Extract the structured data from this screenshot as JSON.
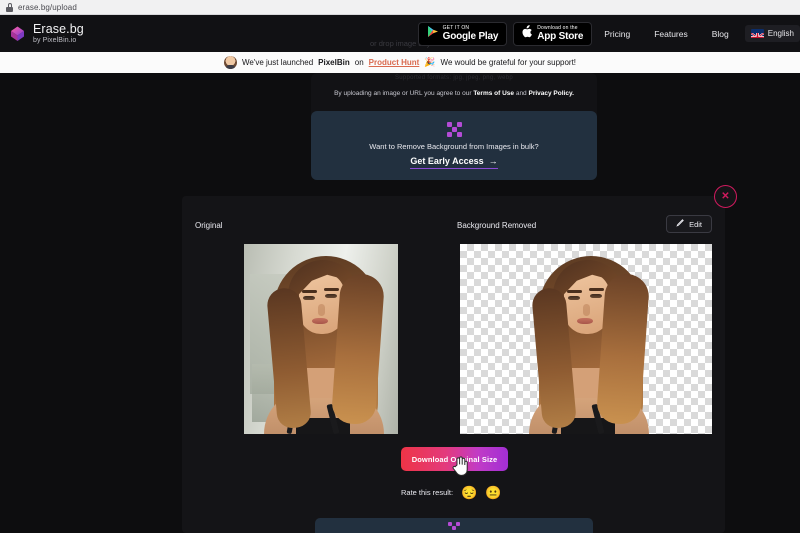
{
  "browser": {
    "url": "erase.bg/upload",
    "lock_icon": "lock-icon"
  },
  "header": {
    "logo_title": "Erase.bg",
    "logo_sub": "by PixelBin.io",
    "logo_icon": "erasebg-cube-logo-icon",
    "drop_hint": "or drop image anywhere",
    "badges": [
      {
        "small": "GET IT ON",
        "large": "Google Play",
        "icon": "google-play-icon"
      },
      {
        "small": "Download on the",
        "large": "App Store",
        "icon": "apple-icon"
      }
    ],
    "links": [
      "Pricing",
      "Features",
      "Blog"
    ],
    "language": {
      "label": "English",
      "flag_icon": "uk-flag-icon"
    }
  },
  "announcement": {
    "avatar_icon": "user-avatar",
    "text_before": "We've just launched",
    "brand": "PixelBin",
    "text_on": "on",
    "product_hunt": "Product Hunt",
    "party_icon": "party-popper-icon",
    "text_after": "We would be grateful for your support!"
  },
  "upload": {
    "supported_formats": "Supported formats:  jpg,  jpeg,  png,  webp",
    "terms_before": "By uploading an image or URL you agree to our",
    "terms_of_use": "Terms of Use",
    "terms_and": "and",
    "privacy_policy": "Privacy Policy.",
    "bulk": {
      "icon": "bulk-dots-icon",
      "title": "Want to Remove Background from Images in bulk?",
      "cta": "Get Early Access",
      "cta_arrow": "arrow-right-icon"
    }
  },
  "result": {
    "label_original": "Original",
    "label_removed": "Background Removed",
    "edit_button": "Edit",
    "edit_icon": "pencil-icon",
    "close_icon": "close-x-icon",
    "original_alt": "portrait-photo-original",
    "removed_alt": "portrait-photo-background-removed",
    "download_label": "Download Original Size",
    "cursor_icon": "hand-pointer-cursor",
    "rate_label": "Rate this result:",
    "emojis": [
      {
        "glyph": "😔",
        "name": "sad-face-emoji"
      },
      {
        "glyph": "😐",
        "name": "neutral-face-emoji"
      }
    ]
  },
  "bottom_card": {
    "icon": "bulk-dots-icon"
  },
  "colors": {
    "page_bg": "#0d0d0f",
    "header_bg": "#111114",
    "panel_bg": "#141417",
    "bulk_card_bg": "#22303f",
    "accent_pink": "#d11a5e",
    "accent_purple": "#b44bd6",
    "banner_bg": "#fbfbfb",
    "product_hunt_link": "#d96a4f"
  }
}
